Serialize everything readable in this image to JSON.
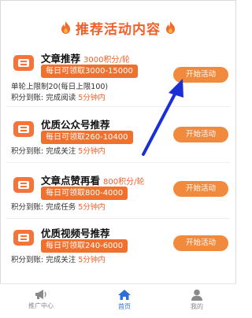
{
  "header": {
    "title": "推荐活动内容"
  },
  "cards": [
    {
      "title": "文章推荐",
      "points": "3000积分/轮",
      "badge": "",
      "lines": [
        {
          "text": "单轮上限制20(每日上限100)",
          "highlight": ""
        },
        {
          "text": "积分到账: 完成阅读",
          "highlight": "5分钟内"
        }
      ],
      "button": "开始活动",
      "inline_badge": "每日可领取3000-15000"
    },
    {
      "title": "优质公众号推荐",
      "points": "",
      "badge": "每日可领取260-10400",
      "lines": [
        {
          "text": "积分到账: 完成关注",
          "highlight": "5分钟内"
        }
      ],
      "button": "开始活动"
    },
    {
      "title": "文章点赞再看",
      "points": "800积分/轮",
      "badge": "每日可领取800-4000",
      "lines": [
        {
          "text": "积分到账: 完成任务",
          "highlight": "5分钟内"
        }
      ],
      "button": "开始活动"
    },
    {
      "title": "优质视频号推荐",
      "points": "",
      "badge": "每日可领取240-6000",
      "lines": [
        {
          "text": "积分到账: 完成关注",
          "highlight": "5分钟内"
        }
      ],
      "button": "开始活动"
    }
  ],
  "tabbar": {
    "items": [
      {
        "label": "推广中心",
        "icon": "megaphone-icon",
        "active": false
      },
      {
        "label": "首页",
        "icon": "home-icon",
        "active": true
      },
      {
        "label": "我的",
        "icon": "user-icon",
        "active": false
      }
    ]
  },
  "colors": {
    "accent": "#f0602a",
    "button": "#f28a3d",
    "tab_active": "#2c6fd6",
    "annotation_arrow": "#1b2fd6"
  }
}
